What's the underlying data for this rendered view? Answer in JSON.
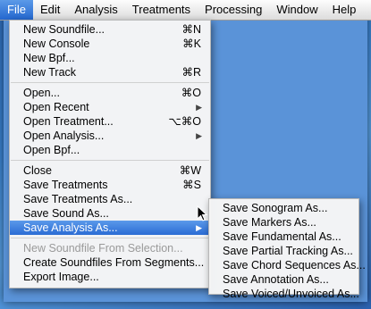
{
  "menubar": {
    "items": [
      "File",
      "Edit",
      "Analysis",
      "Treatments",
      "Processing",
      "Window",
      "Help"
    ]
  },
  "file_menu": {
    "items": [
      {
        "label": "New Soundfile...",
        "shortcut": "⌘N"
      },
      {
        "label": "New Console",
        "shortcut": "⌘K"
      },
      {
        "label": "New Bpf...",
        "shortcut": ""
      },
      {
        "label": "New Track",
        "shortcut": "⌘R"
      },
      {
        "label": "Open...",
        "shortcut": "⌘O"
      },
      {
        "label": "Open Recent",
        "shortcut": "▶"
      },
      {
        "label": "Open Treatment...",
        "shortcut": "⌥⌘O"
      },
      {
        "label": "Open Analysis...",
        "shortcut": "▶"
      },
      {
        "label": "Open Bpf...",
        "shortcut": ""
      },
      {
        "label": "Close",
        "shortcut": "⌘W"
      },
      {
        "label": "Save Treatments",
        "shortcut": "⌘S"
      },
      {
        "label": "Save Treatments As...",
        "shortcut": ""
      },
      {
        "label": "Save Sound As...",
        "shortcut": ""
      },
      {
        "label": "Save Analysis As...",
        "shortcut": "▶"
      },
      {
        "label": "New Soundfile From Selection...",
        "shortcut": ""
      },
      {
        "label": "Create Soundfiles From Segments...",
        "shortcut": ""
      },
      {
        "label": "Export Image...",
        "shortcut": ""
      }
    ]
  },
  "save_analysis_submenu": {
    "items": [
      "Save Sonogram As...",
      "Save Markers As...",
      "Save Fundamental As...",
      "Save Partial Tracking As...",
      "Save Chord Sequences As...",
      "Save Annotation As...",
      "Save Voiced/Unvoiced As..."
    ]
  }
}
